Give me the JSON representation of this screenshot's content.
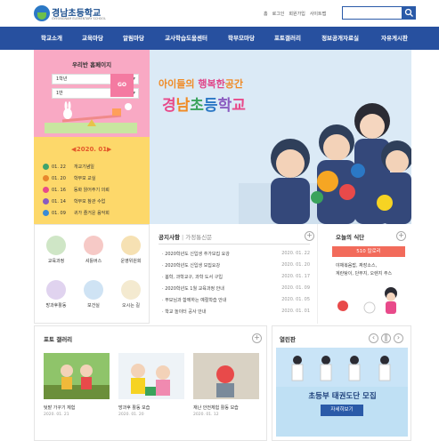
{
  "header": {
    "school_name": "경남초등학교",
    "school_eng": "GYEONGNAM ELEMENTARY SCHOOL",
    "links": [
      "홈",
      "로그인",
      "회원가입",
      "사이트맵"
    ]
  },
  "nav": [
    "학교소개",
    "교육마당",
    "알림마당",
    "교사학습도움센터",
    "학부모마당",
    "포토갤러리",
    "정보공개자료실",
    "자유게시판"
  ],
  "homepage_widget": {
    "title": "우리반 홈페이지",
    "grade_value": "1학년",
    "class_value": "1반",
    "go_label": "GO"
  },
  "calendar": {
    "month": "2020. 01",
    "events": [
      {
        "date": "01. 22",
        "text": "개교기념일",
        "color": "#3fa36c"
      },
      {
        "date": "01. 20",
        "text": "학부모 교실",
        "color": "#e8862d"
      },
      {
        "date": "01. 16",
        "text": "동화 읽어주기 의뢰",
        "color": "#e84a8a"
      },
      {
        "date": "01. 14",
        "text": "학부모 참관 수업",
        "color": "#8a5bc0"
      },
      {
        "date": "01. 09",
        "text": "귀가 즐거운 음악회",
        "color": "#3a8bd6"
      }
    ]
  },
  "banner": {
    "line1_a": "아이들",
    "line1_b": "의 ",
    "line1_c": "행복한",
    "line1_d": "공간",
    "title": "경남초등학교"
  },
  "quick_menu": [
    {
      "label": "교육과정",
      "color": "#cfe6c6",
      "icon": "school-icon"
    },
    {
      "label": "셔틀버스",
      "color": "#f6c9c6",
      "icon": "bus-icon"
    },
    {
      "label": "운영위원회",
      "color": "#f6e1b3",
      "icon": "pencil-icon"
    },
    {
      "label": "방과후활동",
      "color": "#e0d3ef",
      "icon": "palette-icon"
    },
    {
      "label": "보건실",
      "color": "#cfe3f4",
      "icon": "nurse-icon"
    },
    {
      "label": "오시는 길",
      "color": "#f4ead0",
      "icon": "map-pin-icon"
    }
  ],
  "notice": {
    "tab_active": "공지사항",
    "tab_inactive": "가정통신문",
    "rows": [
      {
        "title": "2020학년도 신입생 추가모집 요강",
        "date": "2020. 01. 22"
      },
      {
        "title": "2020학년도 신입생 모집요강",
        "date": "2020. 01. 20"
      },
      {
        "title": "봄학, 과학교구, 과학 도서 구입",
        "date": "2020. 01. 17"
      },
      {
        "title": "2020학년도 1월 교육과정 안내",
        "date": "2020. 01. 09"
      },
      {
        "title": "부모님과 함께하는 예절학습 안내",
        "date": "2020. 01. 05"
      },
      {
        "title": "학교 놀이터 공사 안내",
        "date": "2020. 01. 01"
      }
    ]
  },
  "meal": {
    "title": "오늘의 식단",
    "kcal": "510 칼로리",
    "menu_lines": [
      "야채볶음밥, 짜장소스,",
      "계란탕이, 단무지, 오렌지 주스"
    ]
  },
  "gallery": {
    "title": "포토 갤러리",
    "items": [
      {
        "title": "텃밭 가꾸기 체험",
        "date": "2020. 01. 21"
      },
      {
        "title": "방과후 활동 모습",
        "date": "2020. 01. 20"
      },
      {
        "title": "재난 안전체험 활동 모습",
        "date": "2020. 01. 12"
      }
    ]
  },
  "open_room": {
    "title": "열린판",
    "headline": "초등부 태권도단 모집",
    "button": "자세히보기"
  },
  "colors": {
    "nav": "#27509f",
    "pink": "#f9a9c4",
    "yellow": "#fdd86a",
    "kcal": "#f26b5b"
  }
}
